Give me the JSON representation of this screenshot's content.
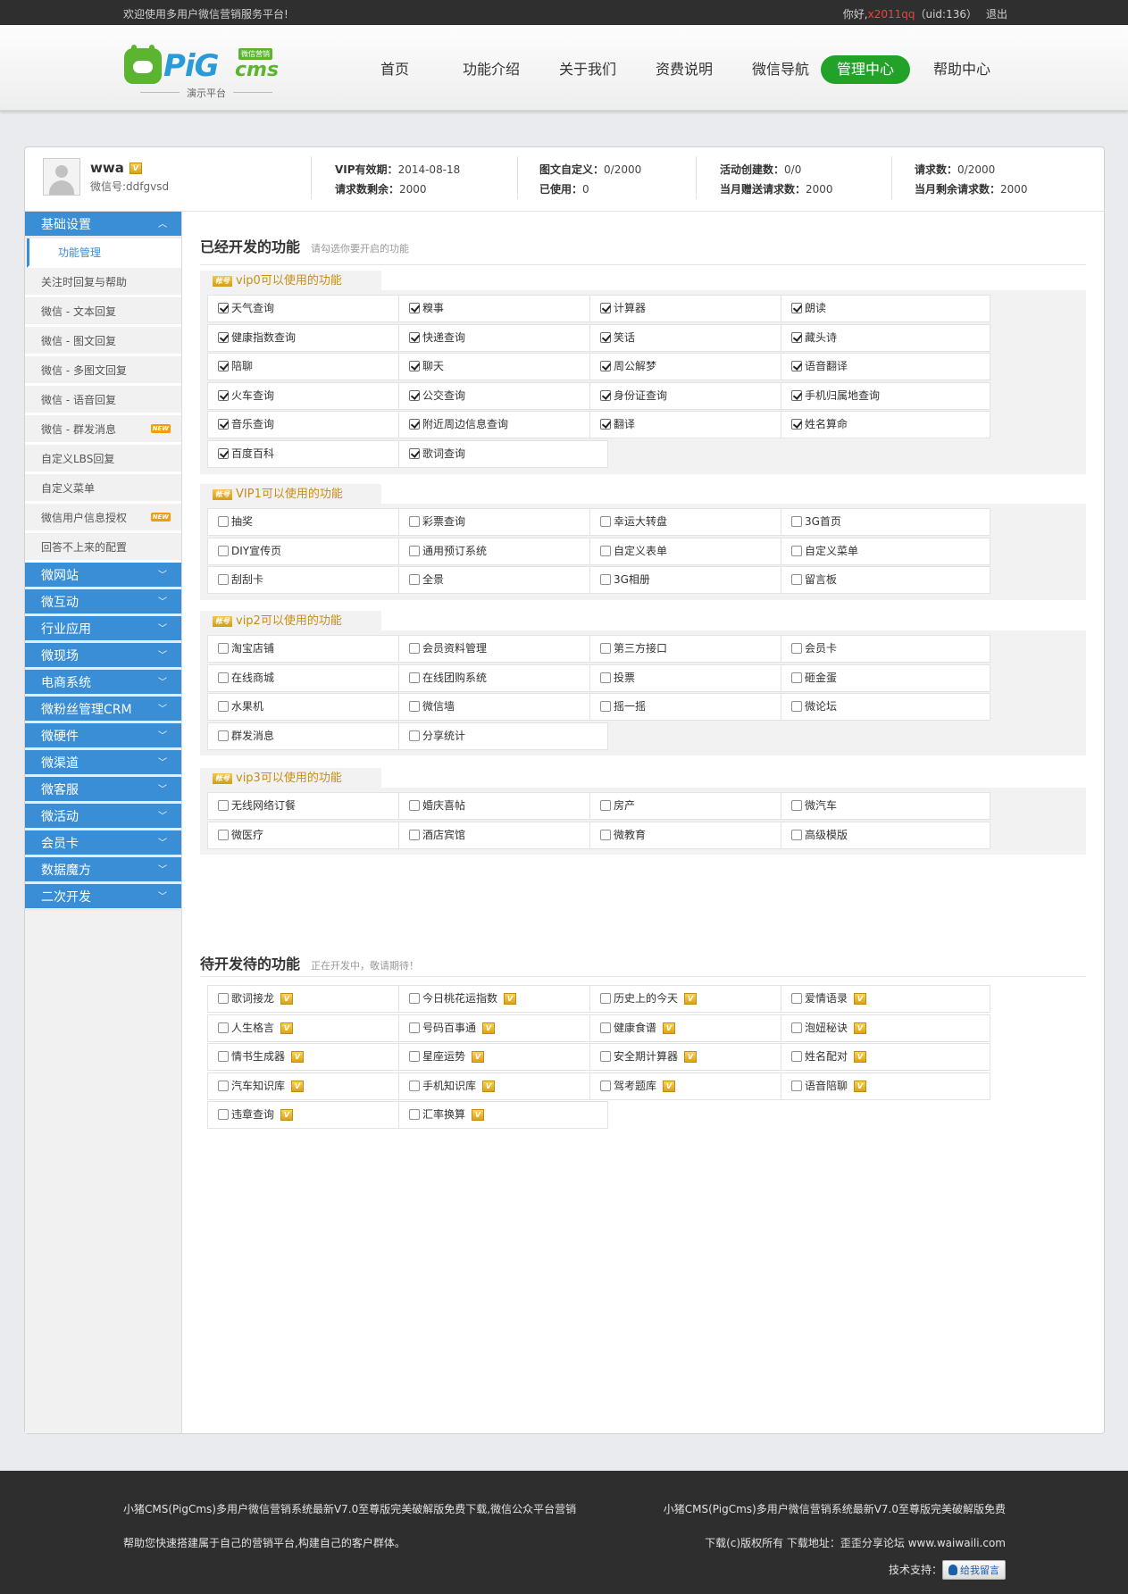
{
  "topbar": {
    "welcome": "欢迎使用多用户微信营销服务平台!",
    "hello": "你好,",
    "username": "x2011qq",
    "uid": "（uid:136）",
    "logout": "退出"
  },
  "logo": {
    "brand": "PiG",
    "brand2": "cms",
    "tag": "微信营销",
    "demo": "演示平台"
  },
  "nav": [
    "首页",
    "功能介绍",
    "关于我们",
    "资费说明",
    "微信导航",
    "管理中心",
    "帮助中心"
  ],
  "user": {
    "name": "wwa",
    "wechat_id": "微信号:ddfgvsd",
    "stats": [
      {
        "l1": "VIP有效期：",
        "v1": "2014-08-18",
        "l2": "请求数剩余：",
        "v2": "2000"
      },
      {
        "l1": "图文自定义：",
        "v1": "0/2000",
        "l2": "已使用：",
        "v2": "0"
      },
      {
        "l1": "活动创建数：",
        "v1": "0/0",
        "l2": "当月赠送请求数：",
        "v2": "2000"
      },
      {
        "l1": "请求数：",
        "v1": "0/2000",
        "l2": "当月剩余请求数：",
        "v2": "2000"
      }
    ]
  },
  "sidebar": {
    "basic": "基础设置",
    "sub_items": [
      {
        "label": "功能管理",
        "new": false
      },
      {
        "label": "关注时回复与帮助",
        "new": false
      },
      {
        "label": "微信 - 文本回复",
        "new": false
      },
      {
        "label": "微信 - 图文回复",
        "new": false
      },
      {
        "label": "微信 - 多图文回复",
        "new": false
      },
      {
        "label": "微信 - 语音回复",
        "new": false
      },
      {
        "label": "微信 - 群发消息",
        "new": true
      },
      {
        "label": "自定义LBS回复",
        "new": false
      },
      {
        "label": "自定义菜单",
        "new": false
      },
      {
        "label": "微信用户信息授权",
        "new": true
      },
      {
        "label": "回答不上来的配置",
        "new": false
      }
    ],
    "new_tag": "NEW",
    "sections": [
      "微网站",
      "微互动",
      "行业应用",
      "微现场",
      "电商系统",
      "微粉丝管理CRM",
      "微硬件",
      "微渠道",
      "微客服",
      "微活动",
      "会员卡",
      "数据魔方",
      "二次开发"
    ]
  },
  "developed": {
    "title": "已经开发的功能",
    "hint": "请勾选你要开启的功能"
  },
  "acct_tag": "帐号",
  "groups": [
    {
      "title": "vip0可以使用的功能",
      "checked": true,
      "items": [
        "天气查询",
        "糗事",
        "计算器",
        "朗读",
        "健康指数查询",
        "快递查询",
        "笑话",
        "藏头诗",
        "陪聊",
        "聊天",
        "周公解梦",
        "语音翻译",
        "火车查询",
        "公交查询",
        "身份证查询",
        "手机归属地查询",
        "音乐查询",
        "附近周边信息查询",
        "翻译",
        "姓名算命",
        "百度百科",
        "歌词查询"
      ]
    },
    {
      "title": "VIP1可以使用的功能",
      "checked": false,
      "items": [
        "抽奖",
        "彩票查询",
        "幸运大转盘",
        "3G首页",
        "DIY宣传页",
        "通用预订系统",
        "自定义表单",
        "自定义菜单",
        "刮刮卡",
        "全景",
        "3G相册",
        "留言板"
      ]
    },
    {
      "title": "vip2可以使用的功能",
      "checked": false,
      "items": [
        "淘宝店铺",
        "会员资料管理",
        "第三方接口",
        "会员卡",
        "在线商城",
        "在线团购系统",
        "投票",
        "砸金蛋",
        "水果机",
        "微信墙",
        "摇一摇",
        "微论坛",
        "群发消息",
        "分享统计"
      ]
    },
    {
      "title": "vip3可以使用的功能",
      "checked": false,
      "items": [
        "无线网络订餐",
        "婚庆喜帖",
        "房产",
        "微汽车",
        "微医疗",
        "酒店宾馆",
        "微教育",
        "高级模版"
      ]
    }
  ],
  "pending": {
    "title": "待开发待的功能",
    "hint": "正在开发中，敬请期待！",
    "items": [
      "歌词接龙",
      "今日桃花运指数",
      "历史上的今天",
      "爱情语录",
      "人生格言",
      "号码百事通",
      "健康食谱",
      "泡妞秘诀",
      "情书生成器",
      "星座运势",
      "安全期计算器",
      "姓名配对",
      "汽车知识库",
      "手机知识库",
      "驾考题库",
      "语音陪聊",
      "违章查询",
      "汇率换算"
    ]
  },
  "footer": {
    "left1": "小猪CMS(PigCms)多用户微信营销系统最新V7.0至尊版完美破解版免费下载,微信公众平台营销",
    "left2": "帮助您快速搭建属于自己的营销平台,构建自己的客户群体。",
    "right1": "小猪CMS(PigCms)多用户微信营销系统最新V7.0至尊版完美破解版免费",
    "right2": "下载(c)版权所有 下载地址：歪歪分享论坛 www.waiwaili.com",
    "support": "技术支持：",
    "qq": "给我留言"
  }
}
